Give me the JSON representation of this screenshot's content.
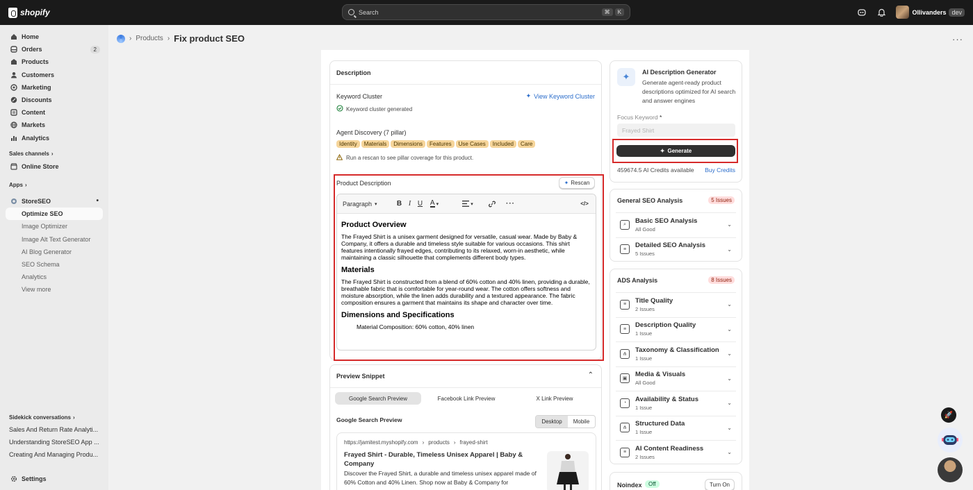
{
  "topbar": {
    "brand": "shopify",
    "search_placeholder": "Search",
    "kbd_cmd": "⌘",
    "kbd_k": "K",
    "store_name": "Ollivanders",
    "store_badge": "dev"
  },
  "sidebar": {
    "main_items": [
      {
        "label": "Home",
        "icon": "home-icon"
      },
      {
        "label": "Orders",
        "icon": "orders-icon",
        "count": "2"
      },
      {
        "label": "Products",
        "icon": "products-icon"
      },
      {
        "label": "Customers",
        "icon": "customers-icon"
      },
      {
        "label": "Marketing",
        "icon": "marketing-icon"
      },
      {
        "label": "Discounts",
        "icon": "discounts-icon"
      },
      {
        "label": "Content",
        "icon": "content-icon"
      },
      {
        "label": "Markets",
        "icon": "markets-icon"
      },
      {
        "label": "Analytics",
        "icon": "analytics-icon"
      }
    ],
    "sales_channels_label": "Sales channels",
    "online_store": "Online Store",
    "apps_label": "Apps",
    "app_name": "StoreSEO",
    "app_sub_items": [
      "Optimize SEO",
      "Image Optimizer",
      "Image Alt Text Generator",
      "AI Blog Generator",
      "SEO Schema",
      "Analytics",
      "View more"
    ],
    "sidekick_label": "Sidekick conversations",
    "sidekick_items": [
      "Sales And Return Rate Analyti...",
      "Understanding StoreSEO App ...",
      "Creating And Managing Produ..."
    ],
    "settings": "Settings"
  },
  "header": {
    "breadcrumb": "Products",
    "title": "Fix product SEO"
  },
  "description_card": {
    "title": "Description",
    "keyword_cluster_label": "Keyword Cluster",
    "view_cluster_link": "View Keyword Cluster",
    "cluster_status": "Keyword cluster generated",
    "agent_discovery_label": "Agent Discovery (7 pillar)",
    "pillars": [
      "Identity",
      "Materials",
      "Dimensions",
      "Features",
      "Use Cases",
      "Included",
      "Care"
    ],
    "rescan_warning": "Run a rescan to see pillar coverage for this product.",
    "product_description_label": "Product Description",
    "rescan_button": "Rescan",
    "paragraph_select": "Paragraph",
    "doc": {
      "h1": "Product Overview",
      "p1": "The Frayed Shirt is a unisex garment designed for versatile, casual wear. Made by Baby & Company, it offers a durable and timeless style suitable for various occasions. This shirt features intentionally frayed edges, contributing to its relaxed, worn-in aesthetic, while maintaining a classic silhouette that complements different body types.",
      "h2": "Materials",
      "p2": "The Frayed Shirt is constructed from a blend of 60% cotton and 40% linen, providing a durable, breathable fabric that is comfortable for year-round wear. The cotton offers softness and moisture absorption, while the linen adds durability and a textured appearance. The fabric composition ensures a garment that maintains its shape and character over time.",
      "h3": "Dimensions and Specifications",
      "p3": "Material Composition: 60% cotton, 40% linen"
    }
  },
  "preview_card": {
    "title": "Preview Snippet",
    "tabs": [
      "Google Search Preview",
      "Facebook Link Preview",
      "X Link Preview"
    ],
    "section_title": "Google Search Preview",
    "device_desktop": "Desktop",
    "device_mobile": "Mobile",
    "url": "https://jamitest.myshopify.com",
    "crumb1": "products",
    "crumb2": "frayed-shirt",
    "result_title": "Frayed Shirt - Durable, Timeless Unisex Apparel | Baby & Company",
    "result_desc": "Discover the Frayed Shirt, a durable and timeless unisex apparel made of 60% Cotton and 40% Linen. Shop now at Baby & Company for"
  },
  "ai_card": {
    "title": "AI Description Generator",
    "desc": "Generate agent-ready product descriptions optimized for AI search and answer engines",
    "focus_label": "Focus Keyword",
    "required_mark": "*",
    "focus_placeholder": "Frayed Shirt",
    "generate_button": "Generate",
    "credits_text": "459674.5 AI Credits available",
    "buy_credits": "Buy Credits"
  },
  "general_seo": {
    "title": "General SEO Analysis",
    "badge": "5 Issues",
    "rows": [
      {
        "title": "Basic SEO Analysis",
        "sub": "All Good"
      },
      {
        "title": "Detailed SEO Analysis",
        "sub": "5 Issues"
      }
    ]
  },
  "ads": {
    "title": "ADS Analysis",
    "badge": "8 Issues",
    "rows": [
      {
        "title": "Title Quality",
        "sub": "2 Issues"
      },
      {
        "title": "Description Quality",
        "sub": "1 Issue"
      },
      {
        "title": "Taxonomy & Classification",
        "sub": "1 Issue"
      },
      {
        "title": "Media & Visuals",
        "sub": "All Good"
      },
      {
        "title": "Availability & Status",
        "sub": "1 Issue"
      },
      {
        "title": "Structured Data",
        "sub": "1 Issue"
      },
      {
        "title": "AI Content Readiness",
        "sub": "2 Issues"
      }
    ]
  },
  "noindex": {
    "label": "Noindex",
    "status": "Off",
    "button": "Turn On"
  },
  "colors": {
    "accent": "#2c6ecb",
    "highlight": "#d62a2a",
    "pill_bg": "#f6d59a",
    "topbar": "#1a1a1a"
  }
}
